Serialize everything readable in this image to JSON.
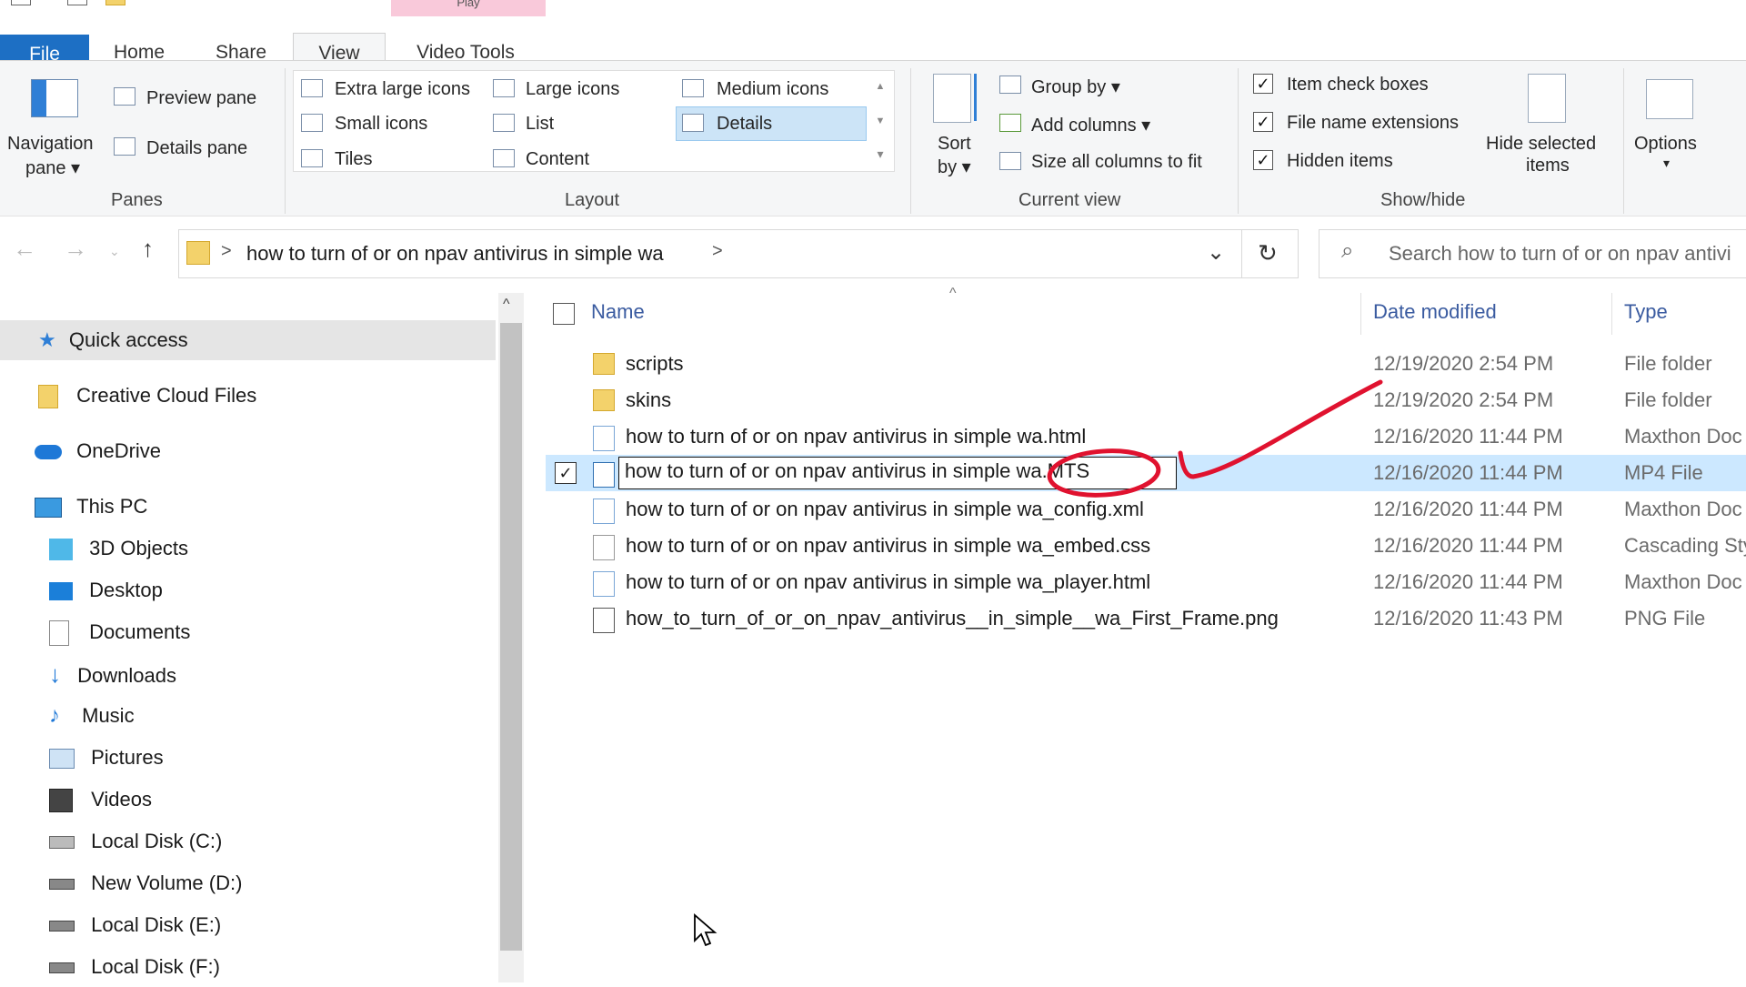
{
  "tabs": {
    "file": "File",
    "home": "Home",
    "share": "Share",
    "view": "View",
    "video_tools": "Video Tools",
    "play_context": "Play"
  },
  "ribbon": {
    "panes": {
      "navigation_pane": "Navigation",
      "navigation_pane_2": "pane ▾",
      "preview_pane": "Preview pane",
      "details_pane": "Details pane",
      "group_title": "Panes"
    },
    "layout": {
      "extra_large_icons": "Extra large icons",
      "large_icons": "Large icons",
      "medium_icons": "Medium icons",
      "small_icons": "Small icons",
      "list": "List",
      "details": "Details",
      "tiles": "Tiles",
      "content": "Content",
      "group_title": "Layout",
      "selected": "Details"
    },
    "current_view": {
      "sort_by": "Sort",
      "sort_by_2": "by ▾",
      "group_by": "Group by ▾",
      "add_columns": "Add columns ▾",
      "size_columns": "Size all columns to fit",
      "group_title": "Current view"
    },
    "show_hide": {
      "item_check_boxes": "Item check boxes",
      "item_check_boxes_checked": true,
      "file_name_extensions": "File name extensions",
      "file_name_extensions_checked": true,
      "hidden_items": "Hidden items",
      "hidden_items_checked": true,
      "hide_selected": "Hide selected",
      "hide_selected_2": "items",
      "group_title": "Show/hide"
    },
    "options": {
      "label": "Options",
      "arrow": "▾"
    }
  },
  "address": {
    "path": "how to turn of or on npav antivirus  in simple  wa",
    "sep": ">",
    "search_placeholder": "Search how to turn of or on npav antivi"
  },
  "nav_pane": {
    "items": [
      {
        "label": "Quick access",
        "icon": "star-icon"
      },
      {
        "label": "Creative Cloud Files",
        "icon": "folder-icon"
      },
      {
        "label": "OneDrive",
        "icon": "cloud-icon"
      },
      {
        "label": "This PC",
        "icon": "computer-icon"
      },
      {
        "label": "3D Objects",
        "icon": "cube-icon"
      },
      {
        "label": "Desktop",
        "icon": "desktop-icon"
      },
      {
        "label": "Documents",
        "icon": "document-icon"
      },
      {
        "label": "Downloads",
        "icon": "download-icon"
      },
      {
        "label": "Music",
        "icon": "music-icon"
      },
      {
        "label": "Pictures",
        "icon": "pictures-icon"
      },
      {
        "label": "Videos",
        "icon": "video-icon"
      },
      {
        "label": "Local Disk (C:)",
        "icon": "drive-icon"
      },
      {
        "label": "New Volume (D:)",
        "icon": "drive-icon"
      },
      {
        "label": "Local Disk (E:)",
        "icon": "drive-icon"
      },
      {
        "label": "Local Disk (F:)",
        "icon": "drive-icon"
      }
    ]
  },
  "file_list": {
    "headers": {
      "name": "Name",
      "date": "Date modified",
      "type": "Type"
    },
    "rows": [
      {
        "name": "scripts",
        "date": "12/19/2020 2:54 PM",
        "type": "File folder",
        "icon": "folder-icon"
      },
      {
        "name": "skins",
        "date": "12/19/2020 2:54 PM",
        "type": "File folder",
        "icon": "folder-icon"
      },
      {
        "name": "how to turn of or on npav antivirus  in simple  wa.html",
        "date": "12/16/2020 11:44 PM",
        "type": "Maxthon Doc",
        "icon": "html-file-icon"
      },
      {
        "name": "how to turn of or on npav antivirus  in simple  wa.MTS",
        "date": "12/16/2020 11:44 PM",
        "type": "MP4 File",
        "icon": "video-file-icon",
        "selected": true
      },
      {
        "name": "how to turn of or on npav antivirus  in simple  wa_config.xml",
        "date": "12/16/2020 11:44 PM",
        "type": "Maxthon Doc",
        "icon": "xml-file-icon"
      },
      {
        "name": "how to turn of or on npav antivirus  in simple  wa_embed.css",
        "date": "12/16/2020 11:44 PM",
        "type": "Cascading Sty",
        "icon": "css-file-icon"
      },
      {
        "name": "how to turn of or on npav antivirus  in simple  wa_player.html",
        "date": "12/16/2020 11:44 PM",
        "type": "Maxthon Doc",
        "icon": "html-file-icon"
      },
      {
        "name": "how_to_turn_of_or_on_npav_antivirus__in_simple__wa_First_Frame.png",
        "date": "12/16/2020 11:43 PM",
        "type": "PNG File",
        "icon": "image-file-icon"
      }
    ]
  },
  "colors": {
    "accent": "#1d6fc4",
    "selection": "#cce8ff",
    "annotation": "#e0122f",
    "header_text": "#3a5ba0"
  }
}
